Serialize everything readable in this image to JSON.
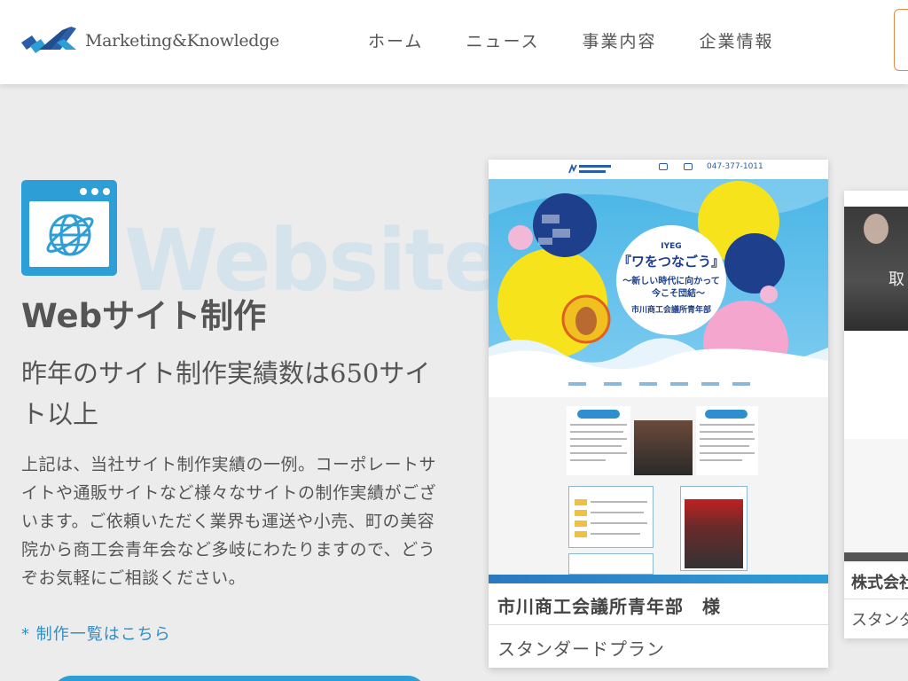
{
  "header": {
    "logo_text": "Marketing&Knowledge",
    "nav": [
      {
        "label": "ホーム"
      },
      {
        "label": "ニュース"
      },
      {
        "label": "事業内容"
      },
      {
        "label": "企業情報"
      }
    ]
  },
  "section": {
    "bg_word": "Website",
    "title": "Webサイト制作",
    "subtitle": "昨年のサイト制作実績数は650サイト以上",
    "description": "上記は、当社サイト制作実績の一例。コーポレートサイトや通販サイトなど様々なサイトの制作実績がございます。ご依頼いただく業界も運送や小売、町の美容院から商工会青年会など多岐にわたりますので、どうぞお気軽にご相談ください。",
    "link": "* 制作一覧はこちら"
  },
  "cards": [
    {
      "client": "市川商工会議所青年部　様",
      "plan": "スタンダードプラン",
      "thumbnail": {
        "phone": "047-377-1011",
        "hero_label": "IYEG",
        "hero_title": "『ワをつなごう』",
        "hero_sub1": "～新しい時代に向かって",
        "hero_sub2": "今こそ団結～",
        "hero_org": "市川商工会議所青年部"
      }
    },
    {
      "client": "株式会社",
      "plan": "スタンダ",
      "overlay": "取"
    }
  ],
  "colors": {
    "accent": "#2e9ed6",
    "link": "#2e8fc6",
    "header_button_border": "#e28a4a"
  },
  "icons": {
    "section_icon": "browser-globe-icon"
  }
}
